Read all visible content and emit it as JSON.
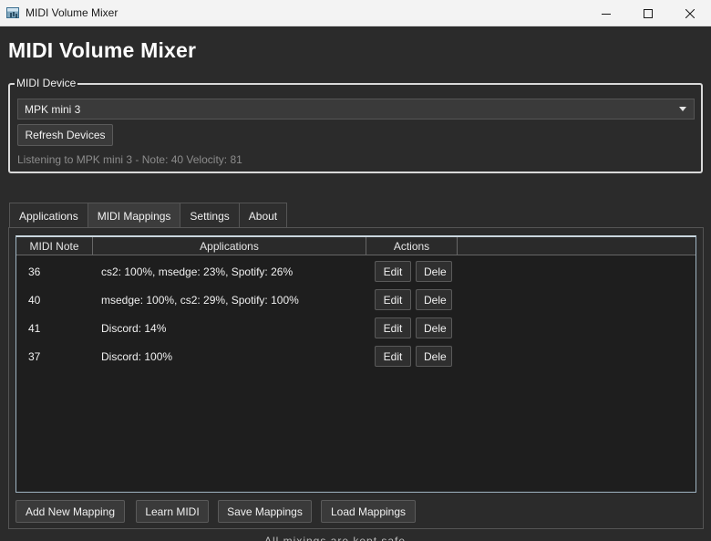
{
  "window": {
    "title": "MIDI Volume Mixer"
  },
  "header": {
    "title": "MIDI Volume Mixer"
  },
  "device_group": {
    "legend": "MIDI Device",
    "selected_device": "MPK mini 3",
    "refresh_label": "Refresh Devices",
    "status": "Listening to MPK mini 3 - Note: 40 Velocity: 81"
  },
  "tabs": [
    {
      "label": "Applications",
      "active": false
    },
    {
      "label": "MIDI Mappings",
      "active": true
    },
    {
      "label": "Settings",
      "active": false
    },
    {
      "label": "About",
      "active": false
    }
  ],
  "table": {
    "columns": [
      "MIDI Note",
      "Applications",
      "Actions"
    ],
    "edit_label": "Edit",
    "delete_label": "Dele",
    "rows": [
      {
        "note": "36",
        "apps": "cs2: 100%, msedge: 23%, Spotify: 26%"
      },
      {
        "note": "40",
        "apps": "msedge: 100%, cs2: 29%, Spotify: 100%"
      },
      {
        "note": "41",
        "apps": "Discord: 14%"
      },
      {
        "note": "37",
        "apps": "Discord: 100%"
      }
    ]
  },
  "footer": {
    "add_label": "Add New Mapping",
    "learn_label": "Learn MIDI",
    "save_label": "Save Mappings",
    "load_label": "Load Mappings",
    "clipped_text": "All mixings are kept safe"
  }
}
